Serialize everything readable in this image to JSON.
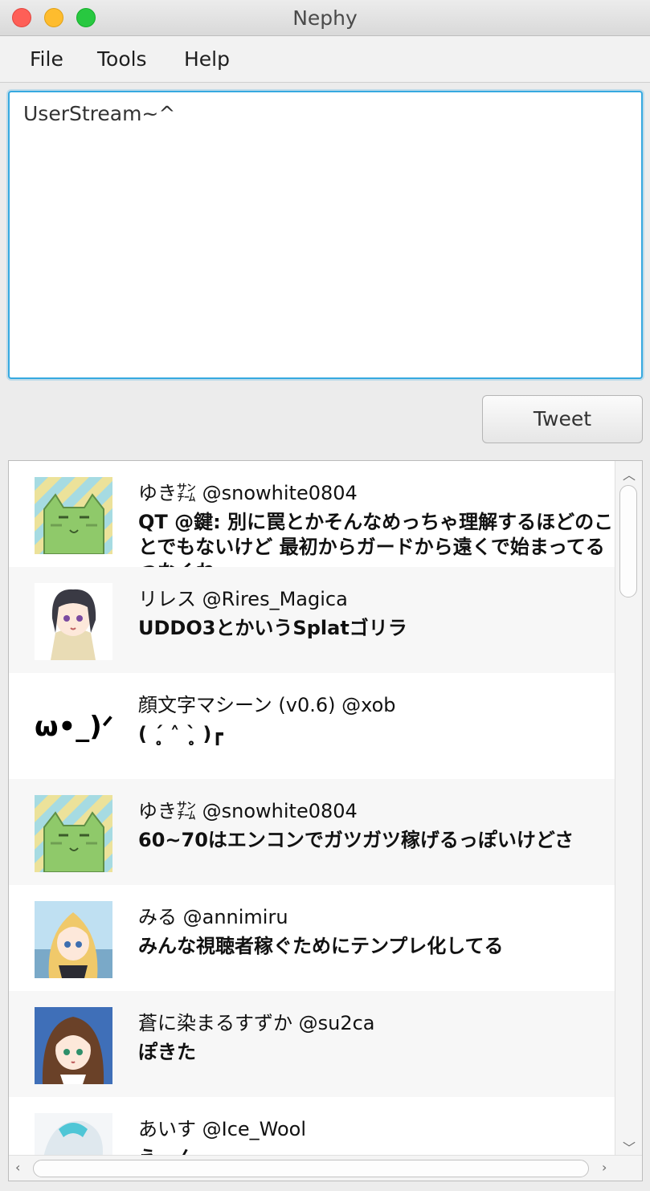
{
  "window": {
    "title": "Nephy"
  },
  "menu": {
    "file": "File",
    "tools": "Tools",
    "help": "Help"
  },
  "compose": {
    "text": "UserStream~^"
  },
  "tweet_button": {
    "label": "Tweet"
  },
  "timeline": [
    {
      "user": "ゆき㌠ @snowhite0804",
      "text": "QT @鍵: 別に罠とかそんなめっちゃ理解するほどのことでもないけど 最初からガードから遠くで始まってる つなくね"
    },
    {
      "user": "リレス @Rires_Magica",
      "text": "UDDO3とかいうSplatゴリラ"
    },
    {
      "user": "顔文字マシーン (v0.6) @xob",
      "text": "( ˊ̥̥̥̥̥ ˄ ˋ̥̥̥̥̥ )┏"
    },
    {
      "user": "ゆき㌠ @snowhite0804",
      "text": "60~70はエンコンでガツガツ稼げるっぽいけどさ"
    },
    {
      "user": "みる @annimiru",
      "text": "みんな視聴者稼ぐためにテンプレ化してる"
    },
    {
      "user": "蒼に染まるすずか @su2ca",
      "text": "ぽきた"
    },
    {
      "user": "あいす @Ice_Wool",
      "text": "えーん"
    }
  ],
  "avatars": {
    "cat_stripes": "#a6dbe2",
    "cat_stripes_alt": "#ece29a",
    "cat_body": "#8fc96a"
  },
  "icons": {
    "scroll_up": "chevron-up-icon",
    "scroll_down": "chevron-down-icon",
    "scroll_left": "chevron-left-icon",
    "scroll_right": "chevron-right-icon"
  }
}
